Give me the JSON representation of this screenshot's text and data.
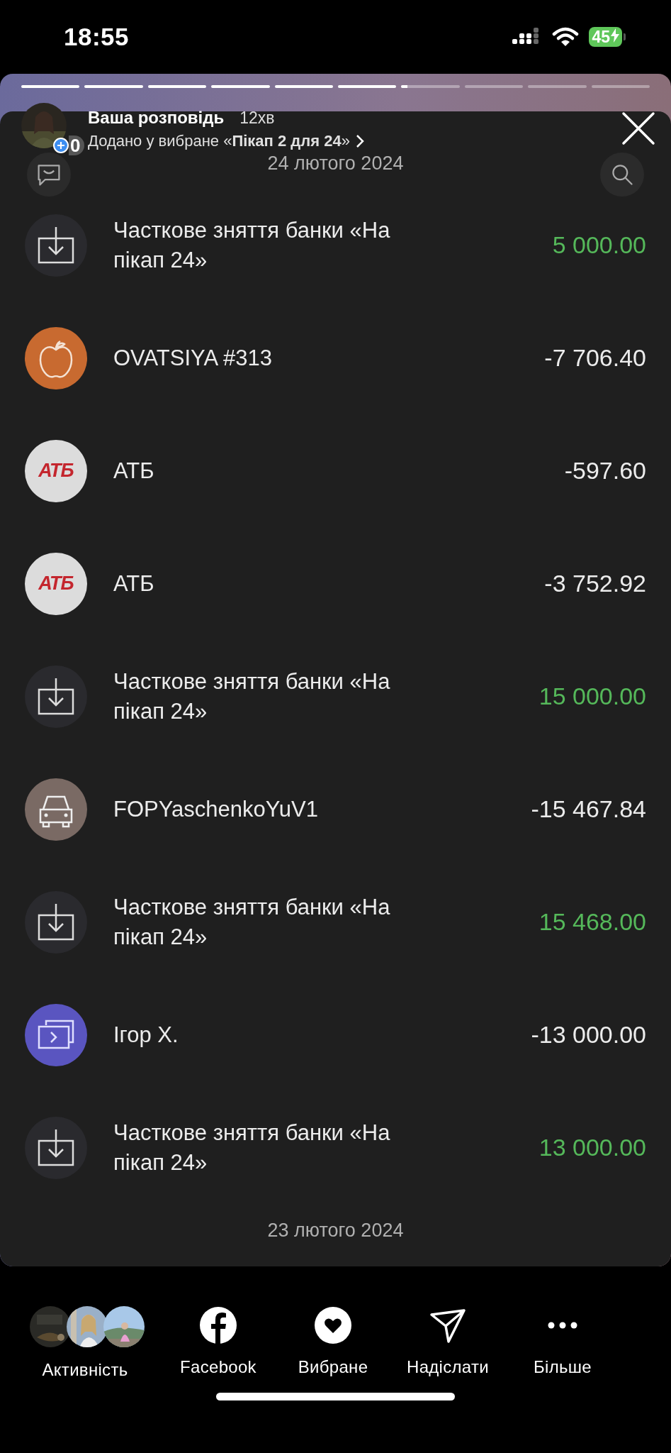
{
  "status_bar": {
    "time": "18:55",
    "battery": "45",
    "charging": true
  },
  "story": {
    "segments": [
      {
        "level": 1
      },
      {
        "level": 1
      },
      {
        "level": 1
      },
      {
        "level": 1
      },
      {
        "level": 1
      },
      {
        "level": 1
      },
      {
        "level": 0.1
      },
      {
        "level": 0
      },
      {
        "level": 0
      },
      {
        "level": 0
      }
    ],
    "author": "Ваша розповідь",
    "time": "12хв",
    "badge_count": "0",
    "saved_note": "Додано у вибране «**Пікап 2 для 24**»"
  },
  "statement": {
    "date_header": "24 лютого 2024",
    "transactions": [
      {
        "kind": "jar",
        "title": "Часткове зняття банки «На пікап 24»",
        "amount": "5 000.00",
        "income": true
      },
      {
        "kind": "food",
        "title": "OVATSIYA #313",
        "amount": "-7 706.40",
        "income": false
      },
      {
        "kind": "atb",
        "logo_text": "АТБ",
        "title": "АТБ",
        "amount": "-597.60",
        "income": false
      },
      {
        "kind": "atb",
        "logo_text": "АТБ",
        "title": "АТБ",
        "amount": "-3 752.92",
        "income": false
      },
      {
        "kind": "jar",
        "title": "Часткове зняття банки «На пікап 24»",
        "amount": "15 000.00",
        "income": true
      },
      {
        "kind": "car",
        "title": "FOPYaschenkoYuV1",
        "amount": "-15 467.84",
        "income": false
      },
      {
        "kind": "jar",
        "title": "Часткове зняття банки «На пікап 24»",
        "amount": "15 468.00",
        "income": true
      },
      {
        "kind": "transfer",
        "title": "Ігор Х.",
        "amount": "-13 000.00",
        "income": false
      },
      {
        "kind": "jar",
        "title": "Часткове зняття банки «На пікап 24»",
        "amount": "13 000.00",
        "income": true
      }
    ],
    "next_date": "23 лютого 2024"
  },
  "bottom_bar": {
    "activity_label": "Активність",
    "actions": [
      {
        "kind": "facebook",
        "label": "Facebook"
      },
      {
        "kind": "favorite",
        "label": "Вибране"
      },
      {
        "kind": "send",
        "label": "Надіслати"
      },
      {
        "kind": "more",
        "label": "Більше"
      }
    ]
  }
}
